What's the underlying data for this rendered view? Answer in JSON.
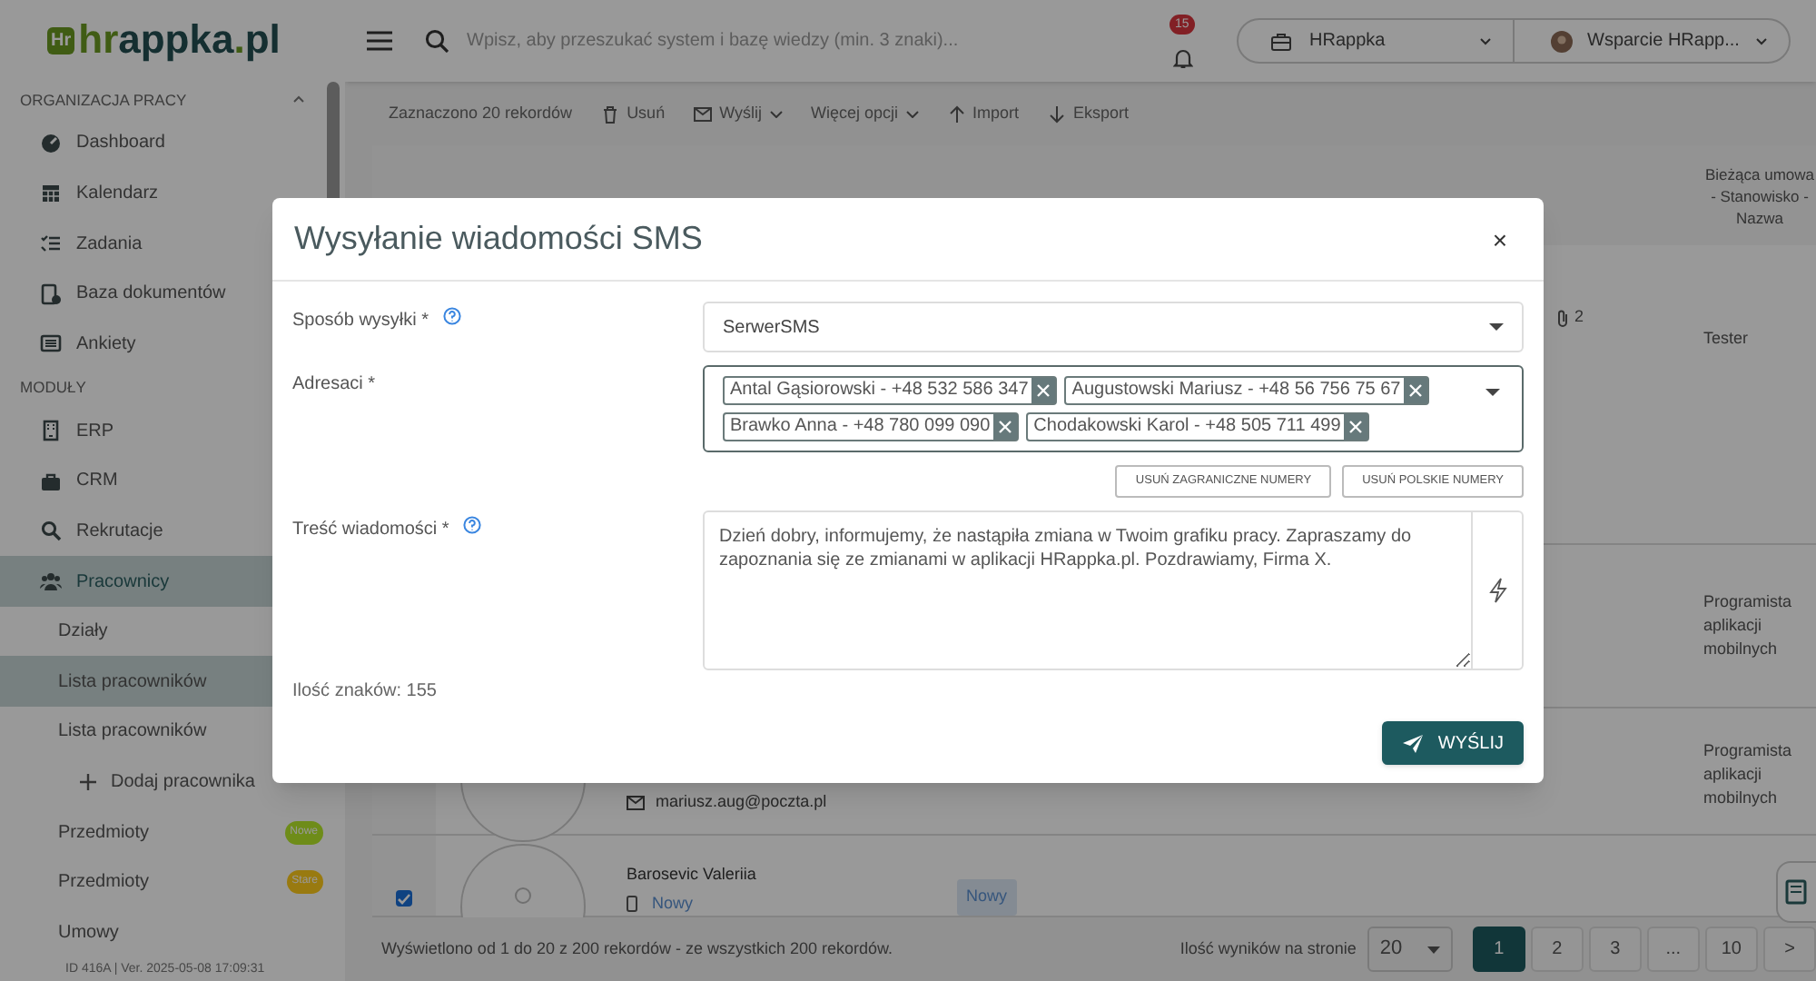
{
  "logo": {
    "badge": "Hr",
    "text": "hrappka",
    "suffix": ".pl"
  },
  "search": {
    "placeholder": "Wpisz, aby przeszukać system i bazę wiedzy (min. 3 znaki)..."
  },
  "notifications": {
    "count": "15"
  },
  "company_select": {
    "value": "HRappka"
  },
  "user_select": {
    "value": "Wsparcie HRapp..."
  },
  "sidebar": {
    "sections": [
      {
        "title": "ORGANIZACJA PRACY",
        "expanded": true,
        "items": [
          {
            "label": "Dashboard",
            "selected": false
          },
          {
            "label": "Kalendarz",
            "selected": false
          },
          {
            "label": "Zadania",
            "selected": false
          },
          {
            "label": "Baza dokumentów",
            "selected": false
          },
          {
            "label": "Ankiety",
            "selected": false
          }
        ]
      },
      {
        "title": "MODUŁY",
        "items": [
          {
            "label": "ERP",
            "selected": false
          },
          {
            "label": "CRM",
            "selected": false
          },
          {
            "label": "Rekrutacje",
            "selected": false
          },
          {
            "label": "Pracownicy",
            "selected": true,
            "children": [
              {
                "label": "Działy",
                "selected": false
              },
              {
                "label": "Lista pracowników",
                "selected": true
              },
              {
                "label": "Lista pracowników",
                "selected": false,
                "children": [
                  {
                    "label": "Dodaj pracownika",
                    "selected": false
                  }
                ]
              },
              {
                "label": "Przedmioty",
                "selected": false,
                "badge": {
                  "text": "Nowe",
                  "color": "#6e8c1a"
                }
              },
              {
                "label": "Przedmioty",
                "selected": false,
                "badge": {
                  "text": "Stare",
                  "color": "#997a10"
                }
              },
              {
                "label": "Umowy",
                "selected": false
              }
            ]
          }
        ]
      }
    ],
    "version": "ID 416A | Ver. 2025-05-08 17:09:31"
  },
  "toolbar": {
    "selection": "Zaznaczono 20 rekordów",
    "actions": [
      {
        "label": "Usuń",
        "dropdown": false
      },
      {
        "label": "Wyślij",
        "dropdown": true
      },
      {
        "label": "Więcej opcji",
        "dropdown": true
      },
      {
        "label": "Import",
        "dropdown": false
      },
      {
        "label": "Eksport",
        "dropdown": false
      }
    ]
  },
  "table": {
    "columns": [
      {
        "label": "Bieżąca umowa - Stanowisko - Nazwa"
      }
    ],
    "rows": [
      {
        "attachments": "2",
        "contract": "Tester"
      },
      {
        "contract": "Programista aplikacji mobilnych"
      },
      {
        "email": "mariusz.aug@poczta.pl",
        "contract": "Programista aplikacji mobilnych"
      },
      {
        "checked": true,
        "name": "Barosevic Valeriia",
        "phone": "Nowy",
        "status": "Nowy"
      }
    ]
  },
  "footer": {
    "summary": "Wyświetlono od 1 do 20 z 200 rekordów - ze wszystkich 200 rekordów.",
    "page_size_label": "Ilość wyników na stronie",
    "page_size": "20",
    "pages": [
      {
        "label": "1",
        "selected": true
      },
      {
        "label": "2",
        "selected": false
      },
      {
        "label": "3",
        "selected": false
      },
      {
        "label": "...",
        "selected": false
      },
      {
        "label": "10",
        "selected": false
      },
      {
        "label": ">",
        "selected": false
      }
    ]
  },
  "dialog": {
    "title": "Wysyłanie wiadomości SMS",
    "close": "×",
    "method": {
      "label": "Sposób wysyłki *",
      "value": "SerwerSMS"
    },
    "recipients": {
      "label": "Adresaci *",
      "items": [
        "Antal Gąsiorowski - +48 532 586 347",
        "Augustowski Mariusz - +48 56 756 75 67",
        "Brawko Anna - +48 780 099 090",
        "Chodakowski Karol - +48 505 711 499"
      ],
      "buttons": [
        "USUŃ ZAGRANICZNE NUMERY",
        "USUŃ POLSKIE NUMERY"
      ]
    },
    "message": {
      "label": "Treść wiadomości *",
      "value": "Dzień dobry, informujemy, że nastąpiła zmiana w Twoim grafiku pracy. Zapraszamy do zapoznania się ze zmianami w aplikacji HRappka.pl. Pozdrawiamy, Firma X."
    },
    "char_count": "Ilość znaków: 155",
    "send": "WYŚLIJ"
  }
}
